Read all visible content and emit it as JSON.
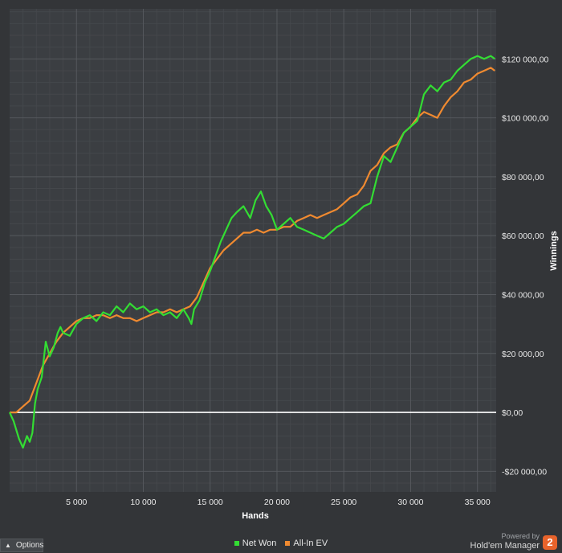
{
  "chart_data": {
    "type": "line",
    "xlabel": "Hands",
    "ylabel": "Winnings",
    "xlim": [
      0,
      36400
    ],
    "ylim": [
      -27000,
      137000
    ],
    "x_ticks": [
      5000,
      10000,
      15000,
      20000,
      25000,
      30000,
      35000
    ],
    "x_tick_labels": [
      "5 000",
      "10 000",
      "15 000",
      "20 000",
      "25 000",
      "30 000",
      "35 000"
    ],
    "y_ticks": [
      -20000,
      0,
      20000,
      40000,
      60000,
      80000,
      100000,
      120000
    ],
    "y_tick_labels": [
      "-$20 000,00",
      "$0,00",
      "$20 000,00",
      "$40 000,00",
      "$60 000,00",
      "$80 000,00",
      "$100 000,00",
      "$120 000,00"
    ],
    "grid": true,
    "legend_position": "bottom",
    "series": [
      {
        "name": "Net Won",
        "color": "#33dd33",
        "points": [
          [
            0,
            0
          ],
          [
            300,
            -3000
          ],
          [
            700,
            -9000
          ],
          [
            1000,
            -12000
          ],
          [
            1300,
            -8000
          ],
          [
            1500,
            -10000
          ],
          [
            1700,
            -7000
          ],
          [
            1900,
            3000
          ],
          [
            2100,
            8000
          ],
          [
            2400,
            12000
          ],
          [
            2700,
            24000
          ],
          [
            3000,
            19000
          ],
          [
            3300,
            22000
          ],
          [
            3600,
            27000
          ],
          [
            3800,
            29000
          ],
          [
            4000,
            27000
          ],
          [
            4500,
            26000
          ],
          [
            5000,
            30000
          ],
          [
            5500,
            32000
          ],
          [
            6000,
            33000
          ],
          [
            6500,
            31000
          ],
          [
            7000,
            34000
          ],
          [
            7500,
            33000
          ],
          [
            8000,
            36000
          ],
          [
            8500,
            34000
          ],
          [
            9000,
            37000
          ],
          [
            9500,
            35000
          ],
          [
            10000,
            36000
          ],
          [
            10500,
            34000
          ],
          [
            11000,
            35000
          ],
          [
            11500,
            33000
          ],
          [
            12000,
            34000
          ],
          [
            12500,
            32000
          ],
          [
            13000,
            35000
          ],
          [
            13400,
            32000
          ],
          [
            13600,
            30000
          ],
          [
            13800,
            35000
          ],
          [
            14200,
            38000
          ],
          [
            14600,
            44000
          ],
          [
            15000,
            48000
          ],
          [
            15400,
            53000
          ],
          [
            15800,
            58000
          ],
          [
            16200,
            62000
          ],
          [
            16600,
            66000
          ],
          [
            17000,
            68000
          ],
          [
            17500,
            70000
          ],
          [
            18000,
            66000
          ],
          [
            18400,
            72000
          ],
          [
            18800,
            75000
          ],
          [
            19200,
            70000
          ],
          [
            19600,
            67000
          ],
          [
            20000,
            62000
          ],
          [
            20500,
            64000
          ],
          [
            21000,
            66000
          ],
          [
            21500,
            63000
          ],
          [
            22000,
            62000
          ],
          [
            22500,
            61000
          ],
          [
            23000,
            60000
          ],
          [
            23500,
            59000
          ],
          [
            24000,
            61000
          ],
          [
            24500,
            63000
          ],
          [
            25000,
            64000
          ],
          [
            25500,
            66000
          ],
          [
            26000,
            68000
          ],
          [
            26500,
            70000
          ],
          [
            27000,
            71000
          ],
          [
            27500,
            80000
          ],
          [
            28000,
            87000
          ],
          [
            28500,
            85000
          ],
          [
            29000,
            90000
          ],
          [
            29500,
            95000
          ],
          [
            30000,
            97000
          ],
          [
            30500,
            99000
          ],
          [
            31000,
            108000
          ],
          [
            31500,
            111000
          ],
          [
            32000,
            109000
          ],
          [
            32500,
            112000
          ],
          [
            33000,
            113000
          ],
          [
            33500,
            116000
          ],
          [
            34000,
            118000
          ],
          [
            34500,
            120000
          ],
          [
            35000,
            121000
          ],
          [
            35500,
            120000
          ],
          [
            36000,
            121000
          ],
          [
            36300,
            120000
          ]
        ]
      },
      {
        "name": "All-In EV",
        "color": "#f08a30",
        "points": [
          [
            0,
            0
          ],
          [
            500,
            0
          ],
          [
            1000,
            2000
          ],
          [
            1500,
            4000
          ],
          [
            2000,
            10000
          ],
          [
            2500,
            16000
          ],
          [
            3000,
            20000
          ],
          [
            3500,
            24000
          ],
          [
            4000,
            27000
          ],
          [
            4500,
            29000
          ],
          [
            5000,
            31000
          ],
          [
            5500,
            32000
          ],
          [
            6000,
            32000
          ],
          [
            6500,
            33000
          ],
          [
            7000,
            33000
          ],
          [
            7500,
            32000
          ],
          [
            8000,
            33000
          ],
          [
            8500,
            32000
          ],
          [
            9000,
            32000
          ],
          [
            9500,
            31000
          ],
          [
            10000,
            32000
          ],
          [
            10500,
            33000
          ],
          [
            11000,
            34000
          ],
          [
            11500,
            34000
          ],
          [
            12000,
            35000
          ],
          [
            12500,
            34000
          ],
          [
            13000,
            35000
          ],
          [
            13500,
            36000
          ],
          [
            14000,
            39000
          ],
          [
            14500,
            44000
          ],
          [
            15000,
            49000
          ],
          [
            15500,
            52000
          ],
          [
            16000,
            55000
          ],
          [
            16500,
            57000
          ],
          [
            17000,
            59000
          ],
          [
            17500,
            61000
          ],
          [
            18000,
            61000
          ],
          [
            18500,
            62000
          ],
          [
            19000,
            61000
          ],
          [
            19500,
            62000
          ],
          [
            20000,
            62000
          ],
          [
            20500,
            63000
          ],
          [
            21000,
            63000
          ],
          [
            21500,
            65000
          ],
          [
            22000,
            66000
          ],
          [
            22500,
            67000
          ],
          [
            23000,
            66000
          ],
          [
            23500,
            67000
          ],
          [
            24000,
            68000
          ],
          [
            24500,
            69000
          ],
          [
            25000,
            71000
          ],
          [
            25500,
            73000
          ],
          [
            26000,
            74000
          ],
          [
            26500,
            77000
          ],
          [
            27000,
            82000
          ],
          [
            27500,
            84000
          ],
          [
            28000,
            88000
          ],
          [
            28500,
            90000
          ],
          [
            29000,
            91000
          ],
          [
            29500,
            95000
          ],
          [
            30000,
            97000
          ],
          [
            30500,
            100000
          ],
          [
            31000,
            102000
          ],
          [
            31500,
            101000
          ],
          [
            32000,
            100000
          ],
          [
            32500,
            104000
          ],
          [
            33000,
            107000
          ],
          [
            33500,
            109000
          ],
          [
            34000,
            112000
          ],
          [
            34500,
            113000
          ],
          [
            35000,
            115000
          ],
          [
            35500,
            116000
          ],
          [
            36000,
            117000
          ],
          [
            36300,
            116000
          ]
        ]
      }
    ]
  },
  "ui": {
    "options_label": "Options",
    "powered_by": "Powered by",
    "brand_name": "Hold'em Manager",
    "brand_logo": "2"
  }
}
